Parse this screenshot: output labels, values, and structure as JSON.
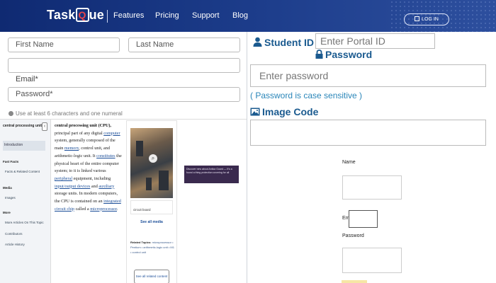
{
  "nav": {
    "logo_prefix": "Task",
    "logo_q": "Q",
    "logo_suffix": "ue",
    "links": [
      "Features",
      "Pricing",
      "Support",
      "Blog"
    ],
    "login_label": "LOG IN"
  },
  "signup": {
    "first_name_placeholder": "First Name",
    "last_name_placeholder": "Last Name",
    "email_label": "Email*",
    "password_label": "Password*",
    "password_hint": "Use at least 6 characters and one numeral"
  },
  "portal": {
    "student_id_label": "Student ID",
    "portal_id_placeholder": "Enter Portal ID",
    "password_label": "Password",
    "password_placeholder": "Enter password",
    "case_note": "( Password is case sensitive )",
    "image_code_label": "Image Code",
    "image_code_value": ""
  },
  "article": {
    "sidebar_title": "central processing unit",
    "sidebar_selected": "Introduction",
    "sidebar_sections": [
      {
        "heading": "Fast Facts",
        "items": [
          "Facts & Related Content"
        ]
      },
      {
        "heading": "Media",
        "items": [
          "Images"
        ]
      },
      {
        "heading": "More",
        "items": [
          "More Articles On This Topic",
          "Contributors",
          "Article History"
        ]
      }
    ],
    "body_bold": "central processing unit (CPU),",
    "body_p1": " principal part of any digital ",
    "link_computer": "computer",
    "body_p2": " system, generally composed of the main ",
    "link_memory": "memory",
    "body_p3": ", control unit, and arithmetic-logic unit. It ",
    "link_constitutes": "constitutes",
    "body_p4": " the physical heart of the entire computer system; to it is linked various ",
    "link_peripheral": "peripheral",
    "body_p5": " equipment, including ",
    "link_io": "input/output devices",
    "body_p6": " and ",
    "link_aux": "auxiliary",
    "body_p7": " storage units. In modern computers, the CPU is contained on an ",
    "link_ic": "integrated circuit chip",
    "body_p8": " called a ",
    "link_micro": "microprocessor",
    "body_p9": ".",
    "image_caption": "circuit board",
    "see_all_media": "See all media",
    "related_label": "Related Topics:",
    "related_topics": "microprocessor • Pentium • arithmetic-logic unit • M1 • control unit",
    "see_all_related": "See all related content →",
    "ad_text": "Discover new about Antica Guard — It's a found a thing protection covering for all"
  },
  "registration": {
    "name_label": "Name",
    "email_label": "Email",
    "password_label": "Password"
  }
}
